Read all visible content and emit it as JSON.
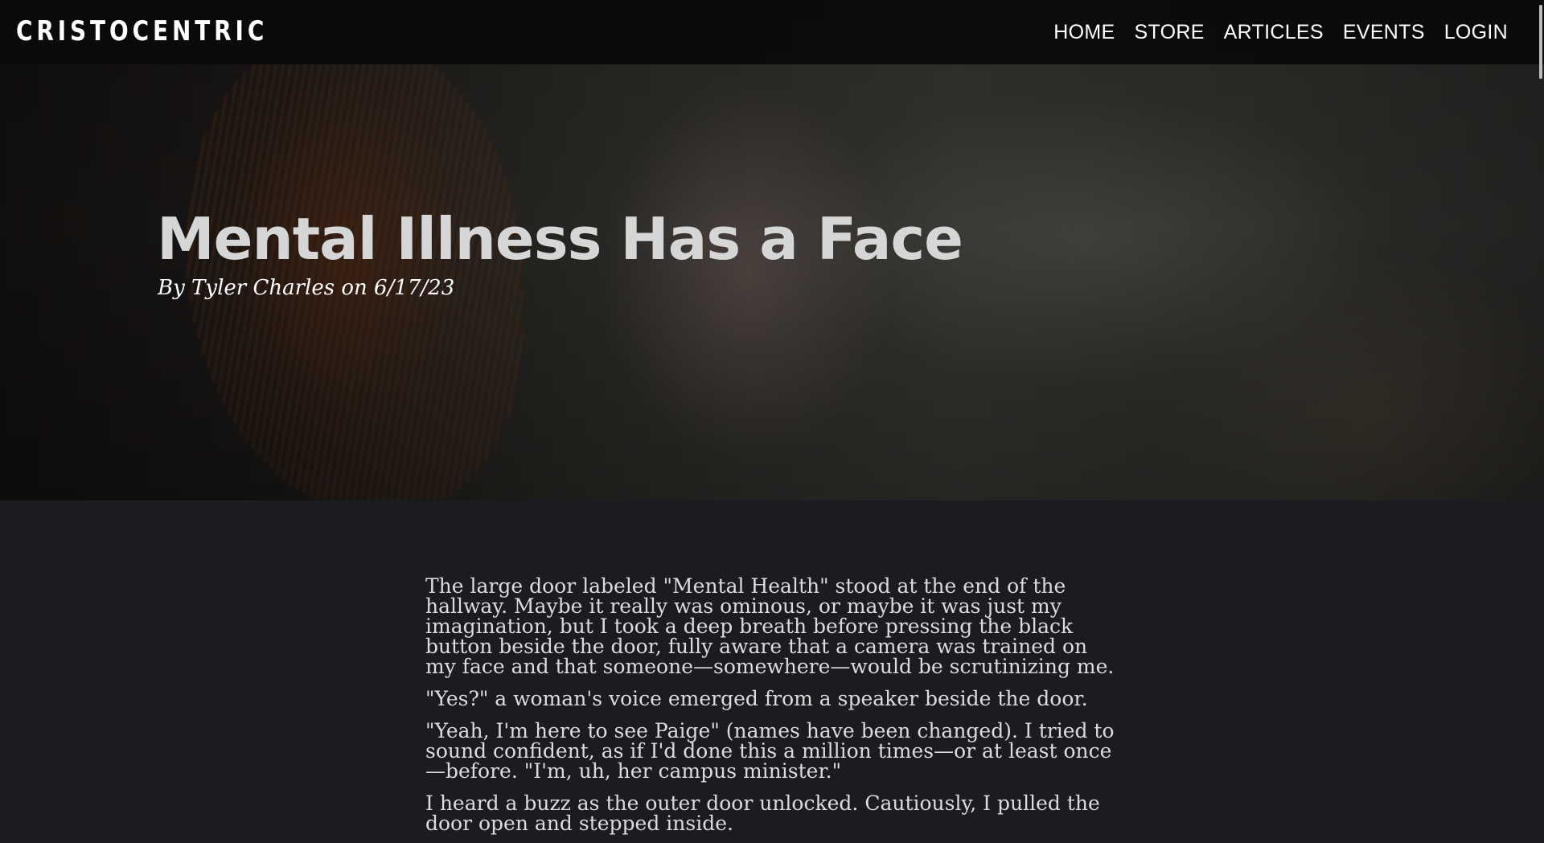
{
  "brand": {
    "name": "CRISTOCENTRIC"
  },
  "nav": {
    "items": [
      {
        "label": "HOME"
      },
      {
        "label": "STORE"
      },
      {
        "label": "ARTICLES"
      },
      {
        "label": "EVENTS"
      },
      {
        "label": "LOGIN"
      }
    ]
  },
  "hero": {
    "title": "Mental Illness Has a Face",
    "byline": "By Tyler Charles on 6/17/23"
  },
  "article": {
    "paragraphs": [
      "The large door labeled \"Mental Health\" stood at the end of the hallway. Maybe it really was ominous, or maybe it was just my imagination, but I took a deep breath before pressing the black button beside the door, fully aware that a camera was trained on my face and that someone—somewhere—would be scrutinizing me.",
      "\"Yes?\" a woman's voice emerged from a speaker beside the door.",
      "\"Yeah, I'm here to see Paige\" (names have been changed). I tried to sound confident, as if I'd done this a million times—or at least once—before. \"I'm, uh, her campus minister.\"",
      "I heard a buzz as the outer door unlocked. Cautiously, I pulled the door open and stepped inside."
    ]
  },
  "colors": {
    "nav_bg": "#0a0a0a",
    "page_bg": "#1c1b20",
    "title_text": "#d6d6d6",
    "body_text": "#dcdcdc"
  }
}
